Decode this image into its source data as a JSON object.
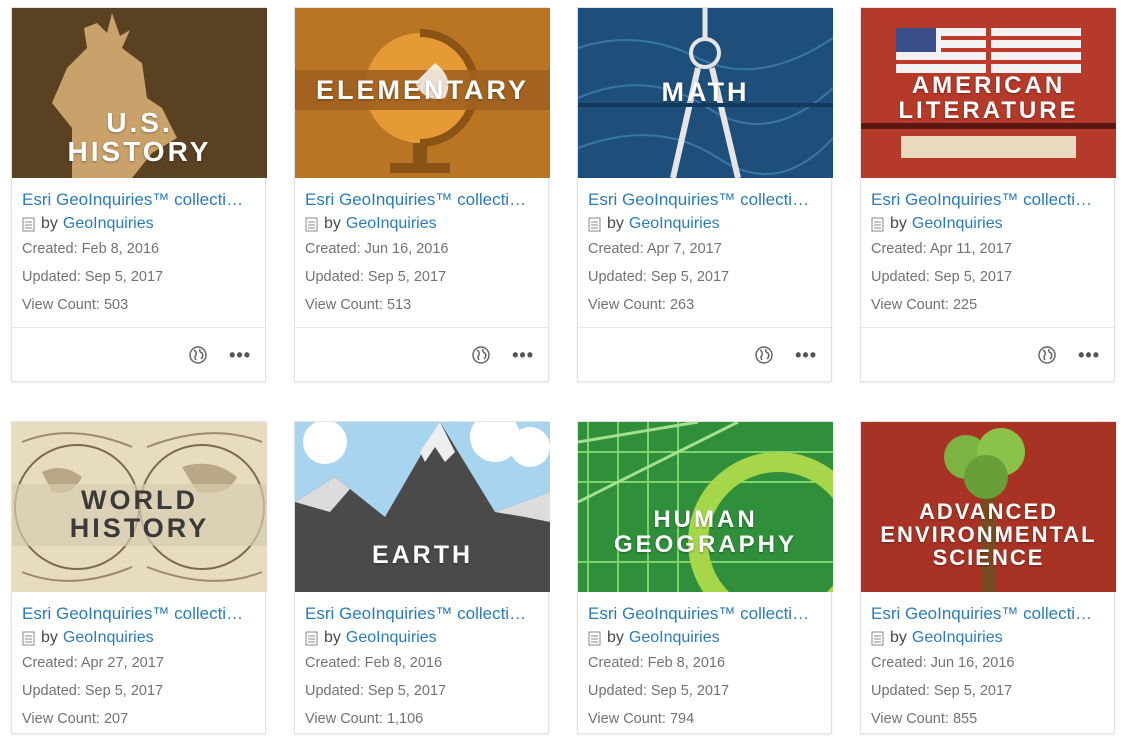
{
  "cards": [
    {
      "title": "Esri GeoInquiries™ collecti…",
      "by": "by",
      "owner": "GeoInquiries",
      "created": "Created: Feb 8, 2016",
      "updated": "Updated: Sep 5, 2017",
      "views": "View Count: 503",
      "thumb_text": "U.S.\nHISTORY",
      "thumb_color": "#5a4122"
    },
    {
      "title": "Esri GeoInquiries™ collecti…",
      "by": "by",
      "owner": "GeoInquiries",
      "created": "Created: Jun 16, 2016",
      "updated": "Updated: Sep 5, 2017",
      "views": "View Count: 513",
      "thumb_text": "ELEMENTARY",
      "thumb_color": "#b97524"
    },
    {
      "title": "Esri GeoInquiries™ collecti…",
      "by": "by",
      "owner": "GeoInquiries",
      "created": "Created: Apr 7, 2017",
      "updated": "Updated: Sep 5, 2017",
      "views": "View Count: 263",
      "thumb_text": "MATH",
      "thumb_color": "#1d4f7a"
    },
    {
      "title": "Esri GeoInquiries™ collecti…",
      "by": "by",
      "owner": "GeoInquiries",
      "created": "Created: Apr 11, 2017",
      "updated": "Updated: Sep 5, 2017",
      "views": "View Count: 225",
      "thumb_text": "AMERICAN\nLITERATURE",
      "thumb_color": "#b63a2a"
    },
    {
      "title": "Esri GeoInquiries™ collecti…",
      "by": "by",
      "owner": "GeoInquiries",
      "created": "Created: Apr 27, 2017",
      "updated": "Updated: Sep 5, 2017",
      "views": "View Count: 207",
      "thumb_text": "WORLD\nHISTORY",
      "thumb_color": "#e7dcc0"
    },
    {
      "title": "Esri GeoInquiries™ collecti…",
      "by": "by",
      "owner": "GeoInquiries",
      "created": "Created: Feb 8, 2016",
      "updated": "Updated: Sep 5, 2017",
      "views": "View Count: 1,106",
      "thumb_text": "EARTH",
      "thumb_color": "#4a4a4a"
    },
    {
      "title": "Esri GeoInquiries™ collecti…",
      "by": "by",
      "owner": "GeoInquiries",
      "created": "Created: Feb 8, 2016",
      "updated": "Updated: Sep 5, 2017",
      "views": "View Count: 794",
      "thumb_text": "HUMAN\nGEOGRAPHY",
      "thumb_color": "#2f8f3a"
    },
    {
      "title": "Esri GeoInquiries™ collecti…",
      "by": "by",
      "owner": "GeoInquiries",
      "created": "Created: Jun 16, 2016",
      "updated": "Updated: Sep 5, 2017",
      "views": "View Count: 855",
      "thumb_text": "ADVANCED\nENVIRONMENTAL\nSCIENCE",
      "thumb_color": "#a83324"
    }
  ],
  "icons": {
    "globe": "globe-icon",
    "more": "more-options-icon",
    "item_type": "document-icon"
  },
  "colors": {
    "link": "#2b7bb9",
    "meta": "#727272"
  }
}
